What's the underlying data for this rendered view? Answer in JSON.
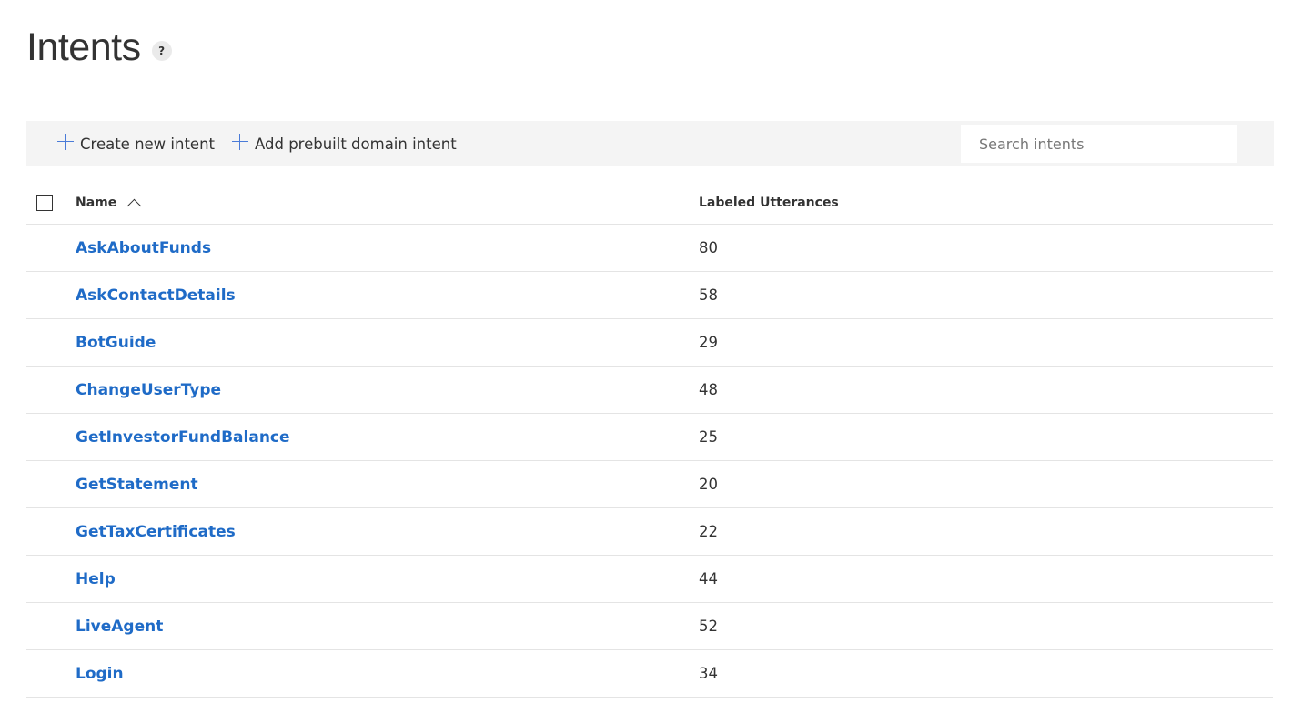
{
  "page": {
    "title": "Intents",
    "help_label": "?"
  },
  "toolbar": {
    "create_label": "Create new intent",
    "prebuilt_label": "Add prebuilt domain intent",
    "search_placeholder": "Search intents"
  },
  "table": {
    "columns": {
      "name": "Name",
      "count": "Labeled Utterances"
    },
    "sort": "name-ascending",
    "rows": [
      {
        "name": "AskAboutFunds",
        "count": "80"
      },
      {
        "name": "AskContactDetails",
        "count": "58"
      },
      {
        "name": "BotGuide",
        "count": "29"
      },
      {
        "name": "ChangeUserType",
        "count": "48"
      },
      {
        "name": "GetInvestorFundBalance",
        "count": "25"
      },
      {
        "name": "GetStatement",
        "count": "20"
      },
      {
        "name": "GetTaxCertificates",
        "count": "22"
      },
      {
        "name": "Help",
        "count": "44"
      },
      {
        "name": "LiveAgent",
        "count": "52"
      },
      {
        "name": "Login",
        "count": "34"
      }
    ]
  },
  "colors": {
    "link": "#1f6bc7",
    "accent": "#4a7bd8",
    "toolbar_bg": "#f4f4f4"
  }
}
